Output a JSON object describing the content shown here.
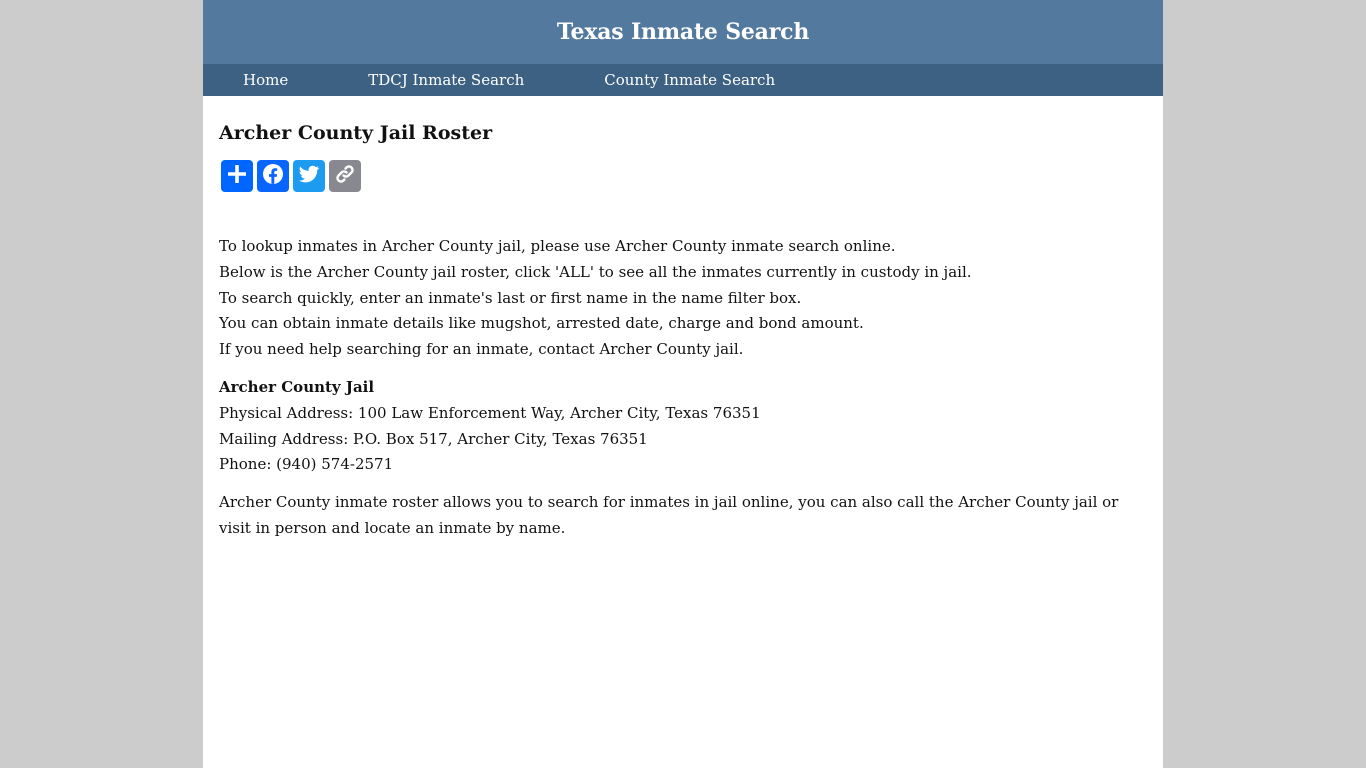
{
  "header": {
    "site_title": "Texas Inmate Search"
  },
  "nav": {
    "items": [
      {
        "label": "Home"
      },
      {
        "label": "TDCJ Inmate Search"
      },
      {
        "label": "County Inmate Search"
      }
    ]
  },
  "main": {
    "page_title": "Archer County Jail Roster",
    "share_buttons": [
      {
        "name": "share",
        "icon": "plus-icon",
        "color": "#0166ff"
      },
      {
        "name": "facebook",
        "icon": "facebook-icon",
        "color": "#0866ff"
      },
      {
        "name": "twitter",
        "icon": "twitter-icon",
        "color": "#1d9bf0"
      },
      {
        "name": "copy-link",
        "icon": "link-icon",
        "color": "#888990"
      }
    ],
    "intro_lines": [
      "To lookup inmates in Archer County jail, please use Archer County inmate search online.",
      "Below is the Archer County jail roster, click 'ALL' to see all the inmates currently in custody in jail.",
      "To search quickly, enter an inmate's last or first name in the name filter box.",
      "You can obtain inmate details like mugshot, arrested date, charge and bond amount.",
      "If you need help searching for an inmate, contact Archer County jail."
    ],
    "jail": {
      "name": "Archer County Jail",
      "physical_address": "Physical Address: 100 Law Enforcement Way, Archer City, Texas 76351",
      "mailing_address": "Mailing Address: P.O. Box 517, Archer City, Texas 76351",
      "phone": "Phone: (940) 574-2571"
    },
    "outro": "Archer County inmate roster allows you to search for inmates in jail online, you can also call the Archer County jail or visit in person and locate an inmate by name."
  },
  "colors": {
    "header_bg": "#537a9e",
    "nav_bg": "#3d6183",
    "page_bg": "#cccccc"
  }
}
